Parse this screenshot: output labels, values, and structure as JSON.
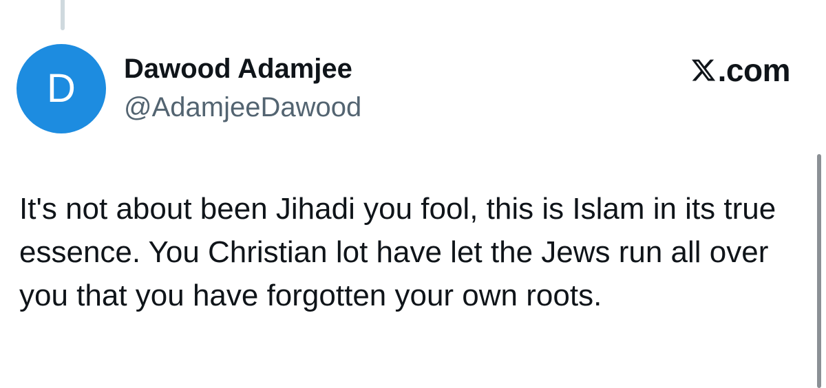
{
  "thread": {
    "connector": true
  },
  "author": {
    "avatar_letter": "D",
    "avatar_color": "#1d8ce0",
    "display_name": "Dawood Adamjee",
    "handle": "@AdamjeeDawood"
  },
  "brand": {
    "logo_icon": "x-logo-icon",
    "text": ".com"
  },
  "tweet": {
    "text": "It's not about been Jihadi you fool, this is Islam in its true essence. You Christian lot have let the Jews run all over you that you have forgotten your own roots."
  },
  "colors": {
    "text_primary": "#0f1419",
    "text_secondary": "#536471",
    "thread_line": "#cfd9de",
    "scrollbar": "#8b9095"
  }
}
